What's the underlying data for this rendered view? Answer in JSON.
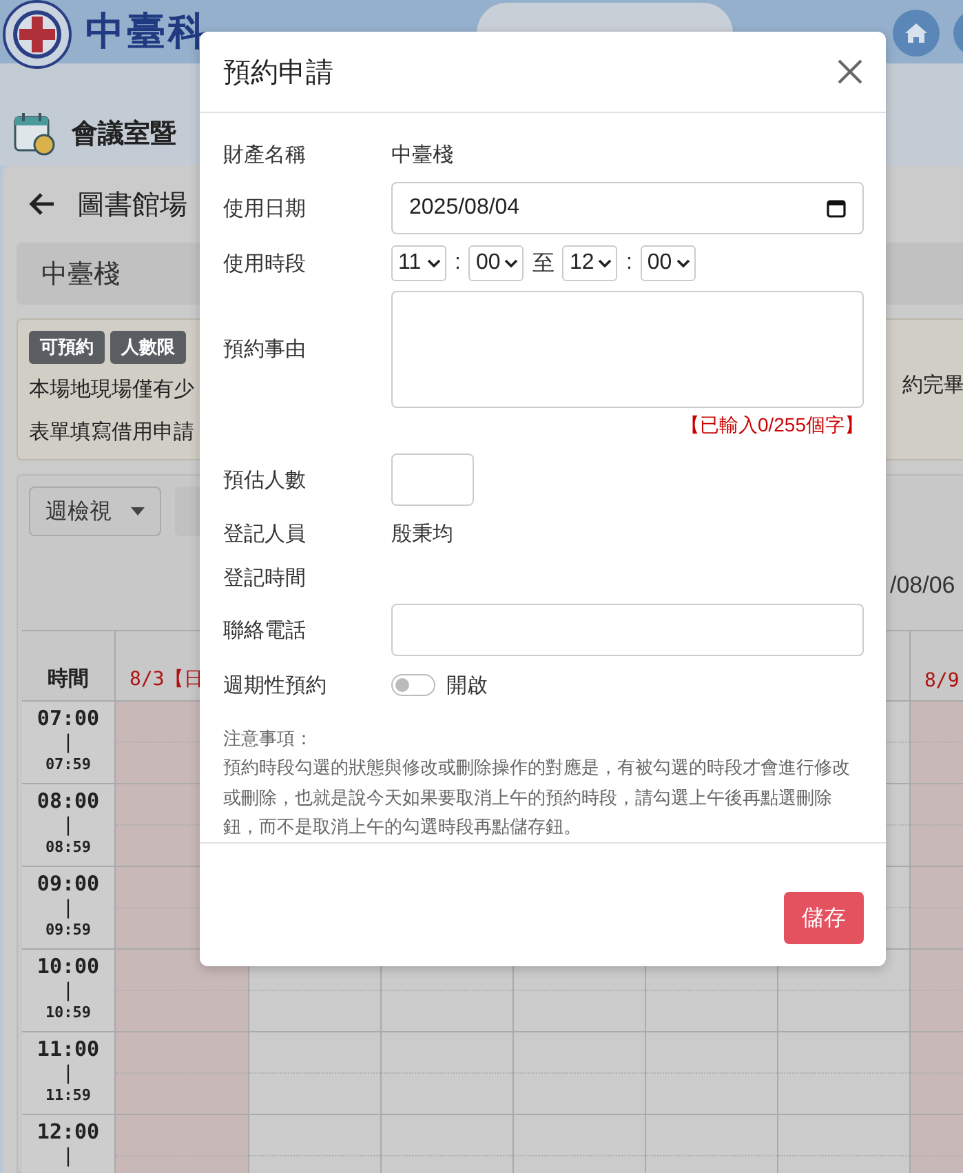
{
  "header": {
    "title": "中臺科"
  },
  "page_title": "會議室暨",
  "back_title": "圖書館場",
  "property_bar": "中臺棧",
  "notice": {
    "badges": [
      "可預約",
      "人數限"
    ],
    "lines": [
      "本場地現場僅有少",
      "表單填寫借用申請"
    ],
    "right_fragment": "約完畢"
  },
  "calendar": {
    "view_select": "週檢視",
    "range_end": "/08/06",
    "time_header": "時間",
    "days": [
      {
        "label": "8/3【日",
        "weekend": true
      },
      {
        "weekend": false
      },
      {
        "weekend": false
      },
      {
        "weekend": false
      },
      {
        "weekend": false
      },
      {
        "weekend": false
      },
      {
        "label": "8/9",
        "weekend": true
      }
    ],
    "slots": [
      {
        "start": "07:00",
        "sep": "|",
        "end": "07:59"
      },
      {
        "start": "08:00",
        "sep": "|",
        "end": "08:59"
      },
      {
        "start": "09:00",
        "sep": "|",
        "end": "09:59"
      },
      {
        "start": "10:00",
        "sep": "|",
        "end": "10:59"
      },
      {
        "start": "11:00",
        "sep": "|",
        "end": "11:59"
      },
      {
        "start": "12:00",
        "sep": "|"
      }
    ]
  },
  "modal": {
    "title": "預約申請",
    "fields": [
      {
        "kind": "text",
        "label": "財產名稱",
        "value": "中臺棧"
      },
      {
        "kind": "date",
        "label": "使用日期",
        "value": "2025/08/04"
      },
      {
        "kind": "time_range",
        "label": "使用時段",
        "start_hour": "11",
        "colon_1": ":",
        "start_minute": "00",
        "separator": "至",
        "end_hour": "12",
        "colon_2": ":",
        "end_minute": "00"
      },
      {
        "kind": "textarea",
        "label": "預約事由",
        "counter": "【已輸入0/255個字】"
      },
      {
        "kind": "short_input",
        "label": "預估人數"
      },
      {
        "kind": "text",
        "label": "登記人員",
        "value": "殷秉均"
      },
      {
        "kind": "text",
        "label": "登記時間"
      },
      {
        "kind": "input",
        "label": "聯絡電話"
      },
      {
        "kind": "toggle",
        "label": "週期性預約",
        "on": false,
        "text": "開啟"
      }
    ],
    "notes_title": "注意事項：",
    "notes": "預約時段勾選的狀態與修改或刪除操作的對應是，有被勾選的時段才會進行修改或刪除，也就是說今天如果要取消上午的預約時段，請勾選上午後再點選刪除鈕，而不是取消上午的勾選時段再點儲存鈕。",
    "save_button": "儲存"
  }
}
